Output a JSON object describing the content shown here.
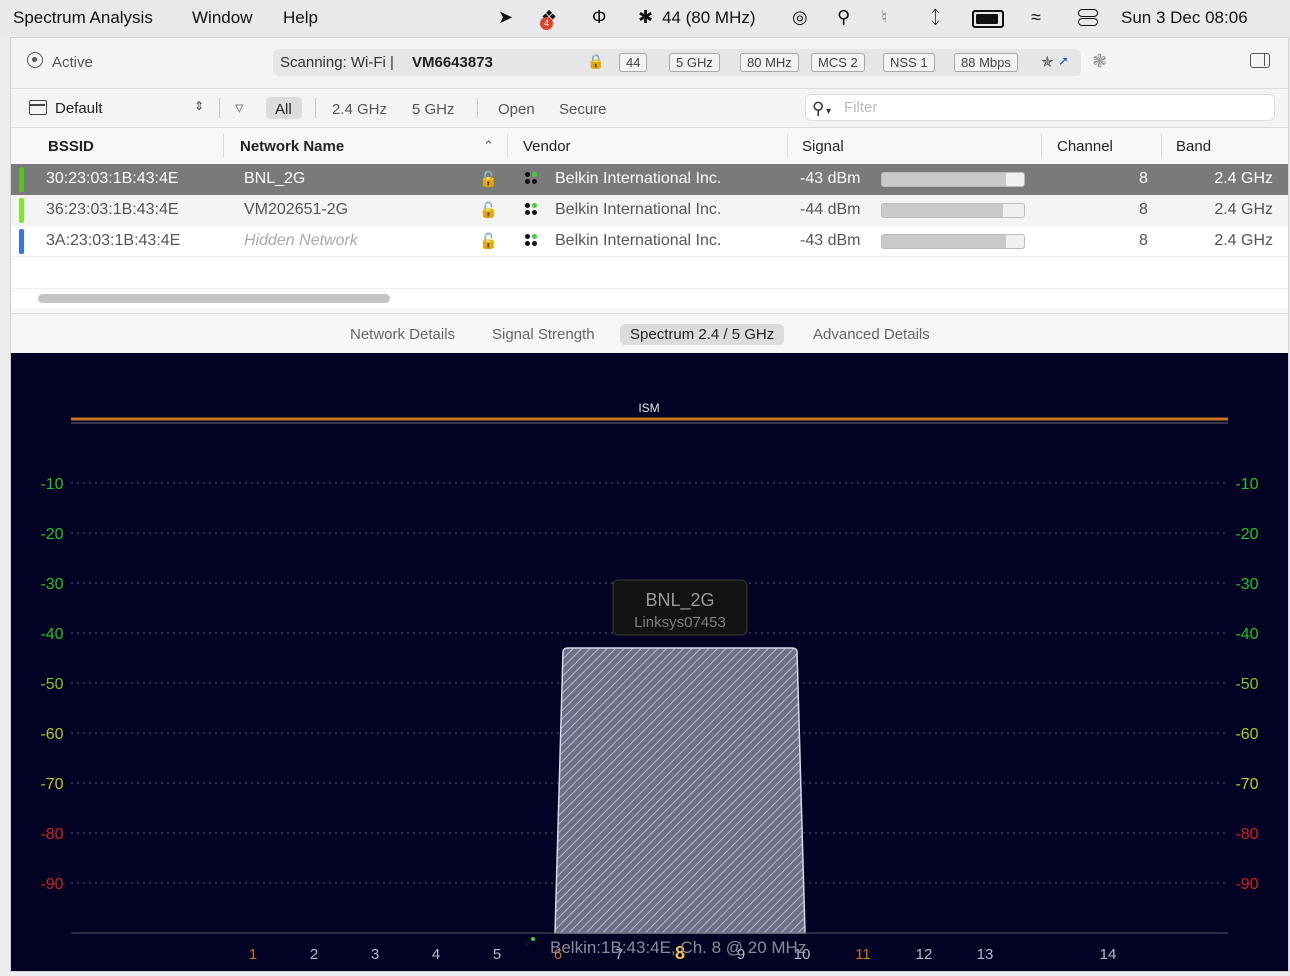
{
  "menubar": {
    "app_name": "Spectrum Analysis",
    "menus": [
      "Window",
      "Help"
    ],
    "dropbox_badge": "4",
    "wifi_status": "44 (80 MHz)",
    "clock": "Sun 3 Dec  08:06"
  },
  "toolbar": {
    "status": "Active",
    "scanning_prefix": "Scanning: Wi-Fi  |",
    "ssid": "VM6643873",
    "chips": [
      "44",
      "5 GHz",
      "80 MHz",
      "MCS 2",
      "NSS 1",
      "88 Mbps"
    ]
  },
  "filterbar": {
    "profile": "Default",
    "filters": [
      "All",
      "2.4 GHz",
      "5 GHz",
      "Open",
      "Secure"
    ],
    "selected_filter": "All",
    "search_placeholder": "Filter"
  },
  "table": {
    "columns": [
      "BSSID",
      "Network Name",
      "Vendor",
      "Signal",
      "Channel",
      "Band"
    ],
    "rows": [
      {
        "bssid": "30:23:03:1B:43:4E",
        "name": "BNL_2G",
        "vendor": "Belkin International Inc.",
        "signal": "-43 dBm",
        "signal_level": 0.87,
        "channel": "8",
        "band": "2.4 GHz",
        "color": "#5cc02a",
        "selected": true
      },
      {
        "bssid": "36:23:03:1B:43:4E",
        "name": "VM202651-2G",
        "vendor": "Belkin International Inc.",
        "signal": "-44 dBm",
        "signal_level": 0.85,
        "channel": "8",
        "band": "2.4 GHz",
        "color": "#7ee82a",
        "selected": false
      },
      {
        "bssid": "3A:23:03:1B:43:4E",
        "name": "Hidden Network",
        "vendor": "Belkin International Inc.",
        "signal": "-43 dBm",
        "signal_level": 0.87,
        "channel": "8",
        "band": "2.4 GHz",
        "color": "#3a6ff0",
        "selected": false
      }
    ]
  },
  "tabs": [
    "Network Details",
    "Signal Strength",
    "Spectrum 2.4 / 5 GHz",
    "Advanced Details"
  ],
  "selected_tab": "Spectrum 2.4 / 5 GHz",
  "chart_data": {
    "type": "area",
    "band_label": "ISM",
    "y_ticks": [
      -10,
      -20,
      -30,
      -40,
      -50,
      -60,
      -70,
      -80,
      -90
    ],
    "y_tick_colors": {
      "-10": "#22c322",
      "-20": "#22c322",
      "-30": "#22c322",
      "-40": "#22c322",
      "-50": "#7dc71f",
      "-60": "#b3c41b",
      "-70": "#c8c41a",
      "-80": "#d41e1e",
      "-90": "#d41e1e"
    },
    "ylim": [
      -100,
      0
    ],
    "x_ticks": [
      1,
      2,
      3,
      4,
      5,
      6,
      7,
      8,
      9,
      10,
      11,
      12,
      13,
      14
    ],
    "highlight_ticks": {
      "1": "#c8731e",
      "6": "#c8731e",
      "11": "#c8731e",
      "8": "#f2c14e"
    },
    "networks": [
      {
        "name": "BNL_2G",
        "vendor_label": "Linksys07453",
        "channel": 8,
        "width_mhz": 20,
        "signal_dbm": -43,
        "channel_span": [
          6,
          10
        ]
      }
    ],
    "footer": "Belkin:1B:43:4E, Ch. 8 @ 20 MHz"
  }
}
